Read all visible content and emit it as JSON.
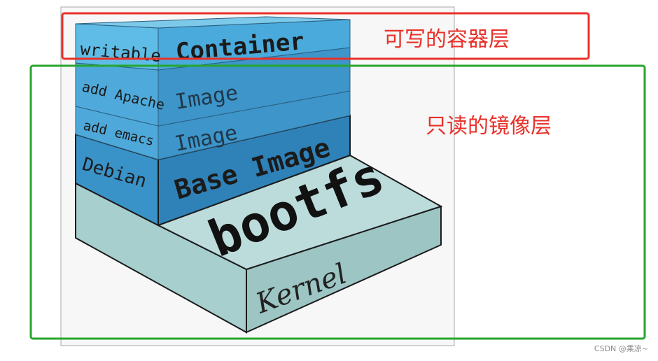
{
  "layers": {
    "writable": "writable",
    "container": "Container",
    "add_apache": "add Apache",
    "image_1": "Image",
    "add_emacs": "add emacs",
    "image_2": "Image",
    "debian": "Debian",
    "base_image": "Base Image",
    "bootfs": "bootfs",
    "kernel": "Kernel"
  },
  "annotations": {
    "writable_container_layer": "可写的容器层",
    "readonly_image_layers": "只读的镜像层"
  },
  "watermark": "CSDN @乘凉~",
  "colors": {
    "annotation_red": "#e8312a",
    "annotation_green": "#27a62e",
    "layer_blue": "#3a92c6",
    "layer_blue_light": "#5dbbe3",
    "kernel_fill": "#a9d0cf"
  }
}
